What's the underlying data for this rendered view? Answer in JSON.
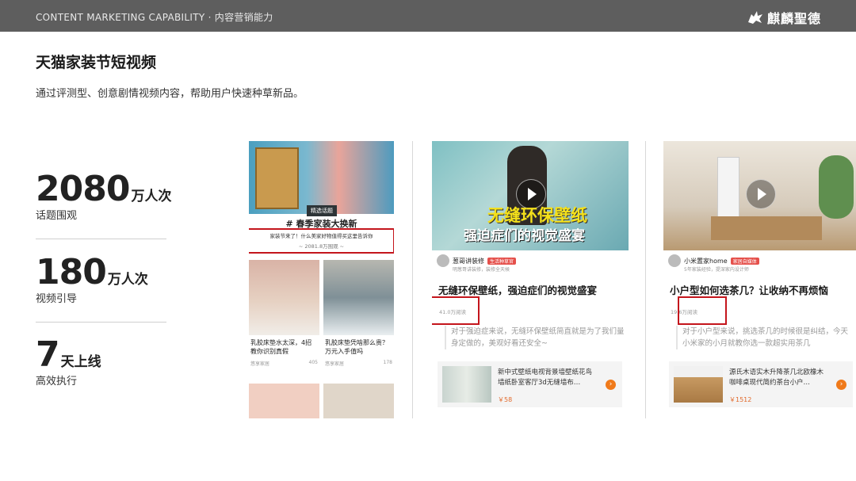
{
  "header": {
    "title": "CONTENT MARKETING CAPABILITY · 内容营销能力",
    "brand": "麒麟聖德"
  },
  "page": {
    "title": "天猫家装节短视频",
    "subtitle": "通过评测型、创意剧情视频内容，帮助用户快速种草新品。"
  },
  "stats": [
    {
      "value": "2080",
      "unit": "万人次",
      "label": "话题围观"
    },
    {
      "value": "180",
      "unit": "万人次",
      "label": "视频引导"
    },
    {
      "value": "7",
      "unit": "天上线",
      "label": "高效执行"
    }
  ],
  "panel1": {
    "tag": "精选话题",
    "heading": "# 春季家装大换新",
    "note": "家装节来了！什么美家好物值得买这里告诉你",
    "note_views": "~ 2081.8万围观 ~",
    "cards": [
      {
        "title": "乳胶床垫水太深，4招教你识别真假",
        "author": "悠享家居",
        "likes": "405"
      },
      {
        "title": "乳胶床垫凭啥那么贵？万元入手值吗",
        "author": "悠享家居",
        "likes": "178"
      }
    ]
  },
  "panel2": {
    "overlay1": "无缝环保壁纸",
    "overlay2": "强迫症们的视觉盛宴",
    "author": "葱哥讲装修",
    "badge": "生活种草官",
    "author_sub": "明葱哥讲装修，装修全天候",
    "title": "无缝环保壁纸，强迫症们的视觉盛宴",
    "views": "41.0万阅读",
    "desc": "对于强迫症来说，无缝环保壁纸简直就是为了我们量身定做的，美观好看还安全~",
    "product": {
      "title": "新中式壁纸电视背景墙壁纸花鸟墙纸卧室客厅3d无缝墙布…",
      "price": "￥58"
    }
  },
  "panel3": {
    "author": "小米置家home",
    "badge": "家居自媒体",
    "author_sub": "5年家装经验，提深家内设计师",
    "title": "小户型如何选茶几？让收纳不再烦恼",
    "views": "19.6万阅读",
    "desc": "对于小户型来说，挑选茶几的时候很是纠结，今天小米家的小月就教你选一款超实用茶几",
    "product": {
      "title": "源氏木语实木升降茶几北欧橡木咖啡桌现代简约茶台小户…",
      "price": "￥1512"
    }
  },
  "colors": {
    "topbar": "#5e5e5e",
    "highlight": "#c4151c",
    "accent": "#f07a1a"
  }
}
